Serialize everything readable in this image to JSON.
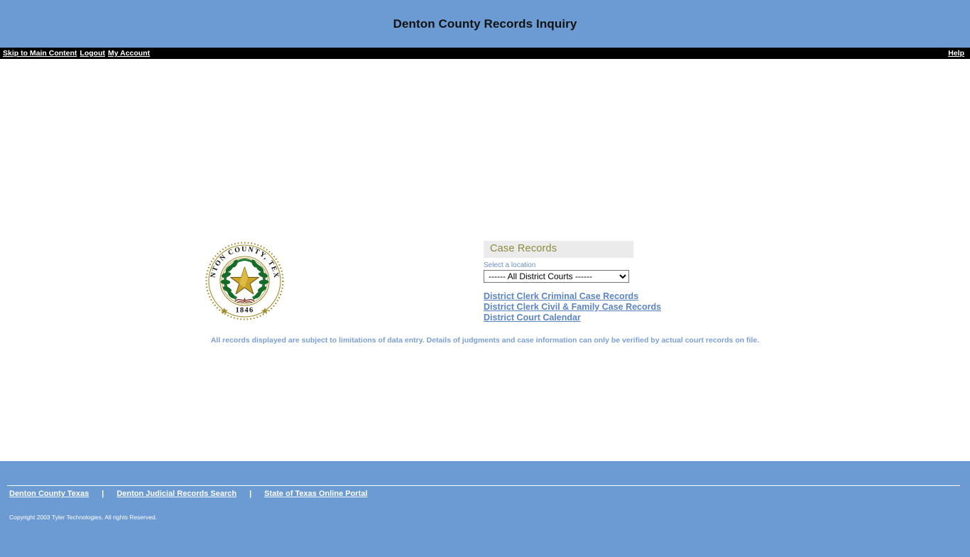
{
  "header": {
    "title": "Denton County Records Inquiry",
    "background_color": "#6b9bd2"
  },
  "nav": {
    "left_links": [
      {
        "label": "Skip to Main Content",
        "name": "skip-to-main-content-link"
      },
      {
        "label": "Logout",
        "name": "logout-link"
      },
      {
        "label": "My Account",
        "name": "my-account-link"
      }
    ],
    "right_links": [
      {
        "label": "Help",
        "name": "help-link"
      }
    ],
    "background_color": "#000000"
  },
  "seal": {
    "top_text": "DENTON COUNTY, TEXAS",
    "year": "1846",
    "alt": "Denton County Texas seal"
  },
  "case_records": {
    "panel_title": "Case Records",
    "panel_title_color": "#8b8b3d",
    "select_label": "Select a location",
    "select_value": "------ All District Courts ------",
    "select_options": [
      "------ All District Courts ------"
    ],
    "links": [
      {
        "label": "District Clerk Criminal Case Records",
        "name": "district-clerk-criminal-case-records-link"
      },
      {
        "label": "District Clerk Civil & Family Case Records",
        "name": "district-clerk-civil-family-case-records-link"
      },
      {
        "label": "District Court Calendar",
        "name": "district-court-calendar-link"
      }
    ],
    "link_color": "#5b84c4"
  },
  "disclaimer": {
    "text": "All records displayed are subject to limitations of data entry. Details of judgments and case information can only be verified by actual court records on file.",
    "color": "#7b9fd4"
  },
  "footer": {
    "links": [
      {
        "label": "Denton County Texas",
        "name": "footer-denton-county-texas-link"
      },
      {
        "label": "Denton Judicial Records Search",
        "name": "footer-denton-judicial-records-search-link"
      },
      {
        "label": "State of Texas Online Portal",
        "name": "footer-state-of-texas-online-portal-link"
      }
    ],
    "separator": "|",
    "copyright": "Copyright 2003 Tyler Technologies. All rights Reserved.",
    "background_color": "#6b9bd2"
  }
}
